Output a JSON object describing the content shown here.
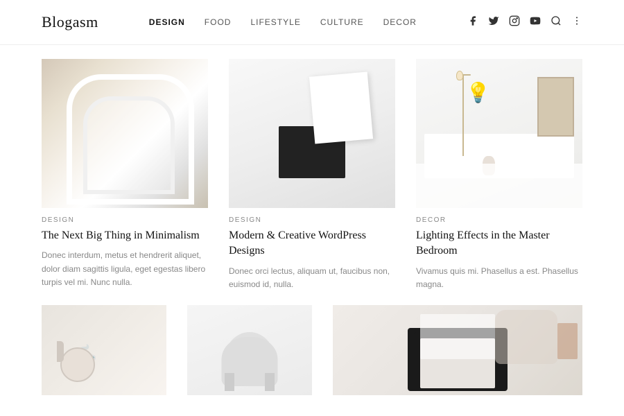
{
  "header": {
    "logo": "Blogasm",
    "nav": {
      "items": [
        {
          "label": "DESIGN",
          "active": true
        },
        {
          "label": "FOOD",
          "active": false
        },
        {
          "label": "LIFESTYLE",
          "active": false
        },
        {
          "label": "CULTURE",
          "active": false
        },
        {
          "label": "DECOR",
          "active": false
        }
      ]
    },
    "icons": {
      "facebook": "f",
      "twitter": "t",
      "instagram": "i",
      "youtube": "y",
      "search": "🔍",
      "menu": "⋮"
    }
  },
  "articles": [
    {
      "category": "DESIGN",
      "title": "The Next Big Thing in Minimalism",
      "excerpt": "Donec interdum, metus et hendrerit aliquet, dolor diam sagittis ligula, eget egestas libero turpis vel mi. Nunc nulla.",
      "image_type": "staircase"
    },
    {
      "category": "DESIGN",
      "title": "Modern & Creative WordPress Designs",
      "excerpt": "Donec orci lectus, aliquam ut, faucibus non, euismod id, nulla.",
      "image_type": "notebook"
    },
    {
      "category": "DECOR",
      "title": "Lighting Effects in the Master Bedroom",
      "excerpt": "Vivamus quis mi. Phasellus a est. Phasellus magna.",
      "image_type": "bedroom"
    }
  ],
  "articles_bottom": [
    {
      "image_type": "coffee"
    },
    {
      "image_type": "chair"
    },
    {
      "image_type": "fashion"
    }
  ]
}
